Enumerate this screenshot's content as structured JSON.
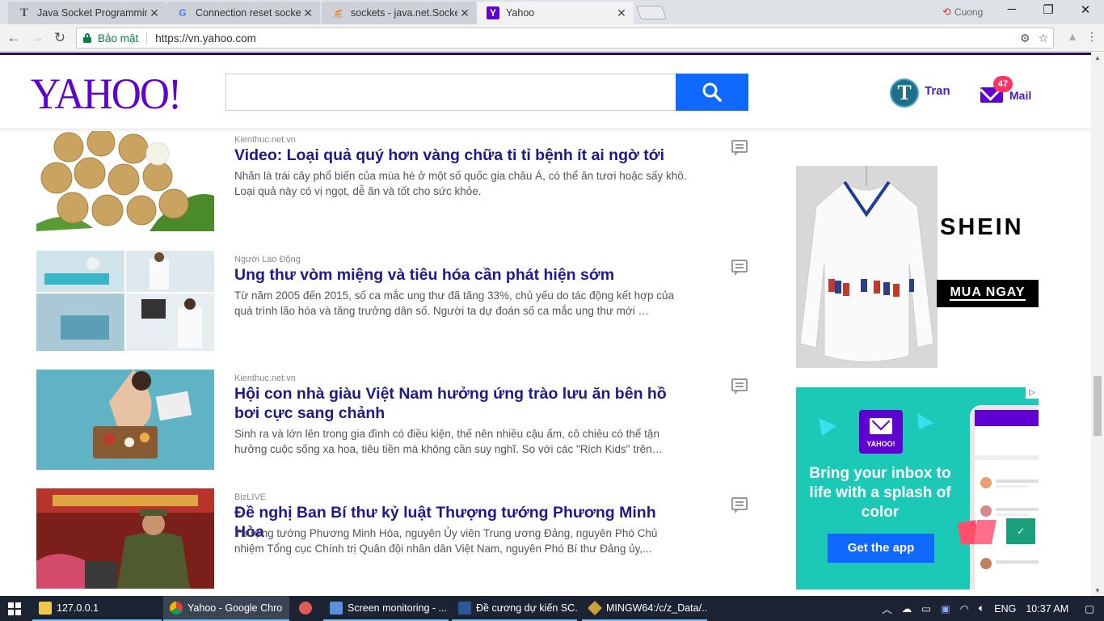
{
  "browser": {
    "tabs": [
      {
        "title": "Java Socket Programming",
        "favicon": "T",
        "favicon_color": "#555555",
        "active": false
      },
      {
        "title": "Connection reset socket j",
        "favicon": "G",
        "favicon_color": "#4285f4",
        "active": false
      },
      {
        "title": "sockets - java.net.Socket",
        "favicon": "stack-overflow-icon",
        "favicon_color": "#f48024",
        "active": false
      },
      {
        "title": "Yahoo",
        "favicon": "Y",
        "favicon_color": "#5f01d1",
        "active": true
      }
    ],
    "profile_name": "Cuong",
    "security_label": "Bảo mật",
    "url": "https://vn.yahoo.com"
  },
  "header": {
    "logo": "YAHOO!",
    "search_placeholder": "",
    "avatar_letter": "T",
    "user_name": "Tran",
    "mail_count": "47",
    "mail_label": "Mail"
  },
  "stories": [
    {
      "provider": "Kienthuc.net.vn",
      "headline": "Video: Loại quả quý hơn vàng chữa ti tỉ bệnh ít ai ngờ tới",
      "summary": "Nhãn là trái cây phổ biến của mùa hè ở một số quốc gia châu Á, có thể ăn tươi hoặc sấy khô. Loại quả này có vị ngọt, dễ ăn và tốt cho sức khỏe."
    },
    {
      "provider": "Người Lao Động",
      "headline": "Ung thư vòm miệng và tiêu hóa cần phát hiện sớm",
      "summary": "Từ năm 2005 đến 2015, số ca mắc ung thư đã tăng 33%, chủ yếu do tác động kết hợp của quá trình lão hóa và tăng trưởng dân số. Người ta dự đoán số ca mắc ung thư mới …"
    },
    {
      "provider": "Kienthuc.net.vn",
      "headline": "Hội con nhà giàu Việt Nam hưởng ứng trào lưu ăn bên hồ bơi cực sang chảnh",
      "summary": "Sinh ra và lớn lên trong gia đình có điều kiện, thế nên nhiều cậu ấm, cô chiêu có thể tận hưởng cuộc sống xa hoa, tiêu tiền mà không cần suy nghĩ. So với các \"Rich Kids\" trên…"
    },
    {
      "provider": "BizLIVE",
      "headline": "Đề nghị Ban Bí thư kỷ luật Thượng tướng Phương Minh Hòa",
      "summary": "Thượng tướng Phương Minh Hòa, nguyên Ủy viên Trung ương Đảng, nguyên Phó Chủ nhiệm Tổng cục Chính trị Quân đội nhân dân Việt Nam, nguyên Phó Bí thư Đảng ủy,..."
    }
  ],
  "ads": {
    "shein_brand": "SHEIN",
    "shein_cta": "MUA NGAY",
    "yahoo_mail_logo_label": "YAHOO!",
    "yahoo_mail_text": "Bring your inbox to life with a splash of color",
    "yahoo_mail_cta": "Get the app"
  },
  "taskbar": {
    "items": [
      {
        "label": "127.0.0.1",
        "icon_color": "#f2c84b"
      },
      {
        "label": "Yahoo - Google Chro",
        "icon_color": "#4285f4"
      },
      {
        "label": "",
        "icon_color": "#e05a5a"
      },
      {
        "label": "Screen monitoring - ...",
        "icon_color": "#5b8fd9"
      },
      {
        "label": "Đề cương dự kiến SC...",
        "icon_color": "#2b579a"
      },
      {
        "label": "MINGW64:/c/z_Data/...",
        "icon_color": "#c9a23a"
      }
    ],
    "language": "ENG",
    "time": "10:37 AM"
  }
}
